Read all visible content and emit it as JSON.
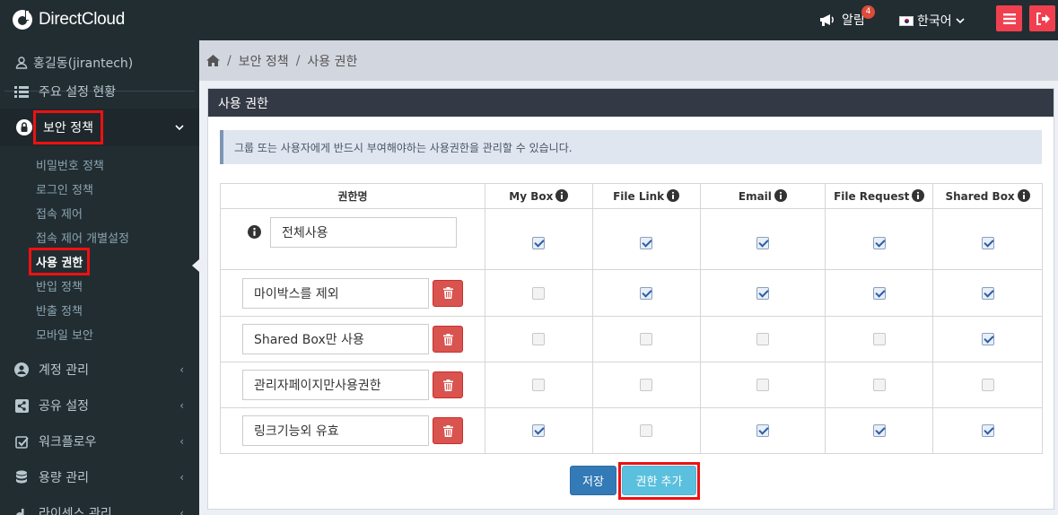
{
  "app": {
    "logo_text": "DirectCloud"
  },
  "topbar": {
    "alert_label": "알림",
    "alert_count": "4",
    "language": "한국어"
  },
  "sidebar": {
    "user": "홍길동(jirantech)",
    "items": [
      {
        "label": "주요 설정 현황"
      },
      {
        "label": "보안 정책"
      },
      {
        "label": "계정 관리"
      },
      {
        "label": "공유 설정"
      },
      {
        "label": "워크플로우"
      },
      {
        "label": "용량 관리"
      },
      {
        "label": "라이센스 관리"
      }
    ],
    "subitems": [
      {
        "label": "비밀번호 정책"
      },
      {
        "label": "로그인 정책"
      },
      {
        "label": "접속 제어"
      },
      {
        "label": "접속 제어 개별설정"
      },
      {
        "label": "사용 권한"
      },
      {
        "label": "반입 정책"
      },
      {
        "label": "반출 정책"
      },
      {
        "label": "모바일 보안"
      }
    ]
  },
  "breadcrumb": {
    "items": [
      "보안 정책",
      "사용 권한"
    ]
  },
  "panel": {
    "title": "사용 권한",
    "info": "그룹 또는 사용자에게 반드시 부여해야하는 사용권한을 관리할 수 있습니다."
  },
  "table": {
    "headers": [
      "권한명",
      "My Box",
      "File Link",
      "Email",
      "File Request",
      "Shared Box"
    ],
    "rows": [
      {
        "name": "전체사용",
        "perms": [
          true,
          true,
          true,
          true,
          true
        ],
        "deletable": false
      },
      {
        "name": "마이박스를 제외",
        "perms": [
          false,
          true,
          true,
          true,
          true
        ],
        "deletable": true
      },
      {
        "name": "Shared Box만 사용",
        "perms": [
          false,
          false,
          false,
          false,
          true
        ],
        "deletable": true
      },
      {
        "name": "관리자페이지만사용권한",
        "perms": [
          false,
          false,
          false,
          false,
          false
        ],
        "deletable": true
      },
      {
        "name": "링크기능외 유효",
        "perms": [
          true,
          false,
          true,
          true,
          true
        ],
        "deletable": true
      }
    ]
  },
  "buttons": {
    "save": "저장",
    "add": "권한 추가"
  },
  "colors": {
    "topbar": "#222d32",
    "accent_red": "#f0404f",
    "save_blue": "#337ab7",
    "add_cyan": "#5bc0de"
  }
}
